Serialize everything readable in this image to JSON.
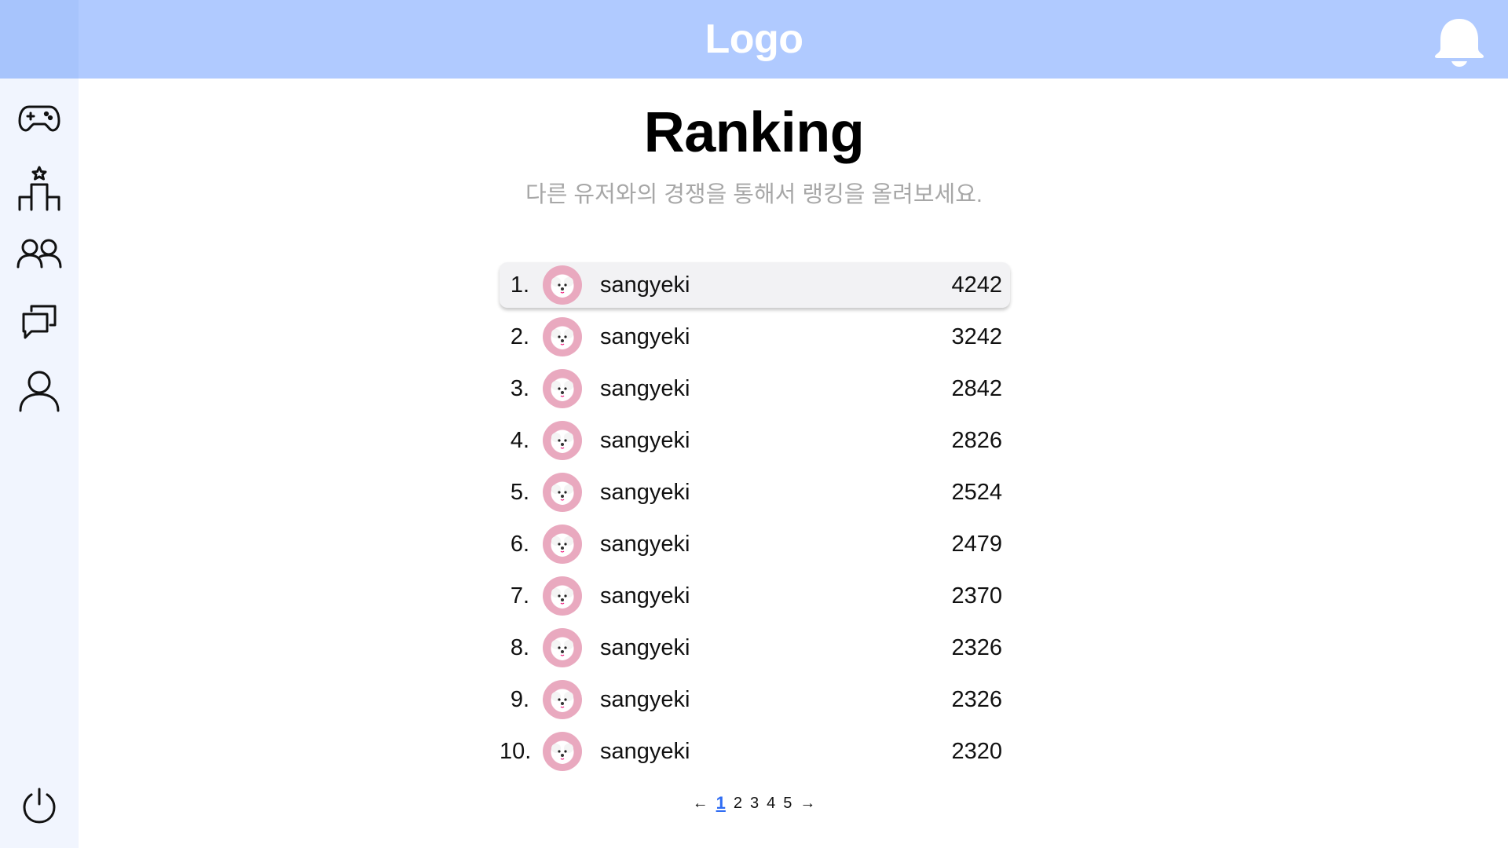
{
  "header": {
    "logo_text": "Logo",
    "notification_icon": "bell-icon",
    "background_color": "#b0caff"
  },
  "sidebar": {
    "items": [
      {
        "icon": "gamepad-icon",
        "label": "game"
      },
      {
        "icon": "podium-icon",
        "label": "ranking"
      },
      {
        "icon": "friends-icon",
        "label": "friends"
      },
      {
        "icon": "chat-icon",
        "label": "chat"
      },
      {
        "icon": "user-icon",
        "label": "profile"
      }
    ],
    "logout_icon": "power-icon"
  },
  "main": {
    "title": "Ranking",
    "subtitle": "다른 유저와의 경쟁을 통해서 랭킹을 올려보세요."
  },
  "ranking": [
    {
      "rank": "1.",
      "username": "sangyeki",
      "score": "4242",
      "active": true
    },
    {
      "rank": "2.",
      "username": "sangyeki",
      "score": "3242",
      "active": false
    },
    {
      "rank": "3.",
      "username": "sangyeki",
      "score": "2842",
      "active": false
    },
    {
      "rank": "4.",
      "username": "sangyeki",
      "score": "2826",
      "active": false
    },
    {
      "rank": "5.",
      "username": "sangyeki",
      "score": "2524",
      "active": false
    },
    {
      "rank": "6.",
      "username": "sangyeki",
      "score": "2479",
      "active": false
    },
    {
      "rank": "7.",
      "username": "sangyeki",
      "score": "2370",
      "active": false
    },
    {
      "rank": "8.",
      "username": "sangyeki",
      "score": "2326",
      "active": false
    },
    {
      "rank": "9.",
      "username": "sangyeki",
      "score": "2326",
      "active": false
    },
    {
      "rank": "10.",
      "username": "sangyeki",
      "score": "2320",
      "active": false
    }
  ],
  "pagination": {
    "prev": "←",
    "next": "→",
    "pages": [
      "1",
      "2",
      "3",
      "4",
      "5"
    ],
    "current": "1",
    "current_color": "#2f6cf3"
  }
}
